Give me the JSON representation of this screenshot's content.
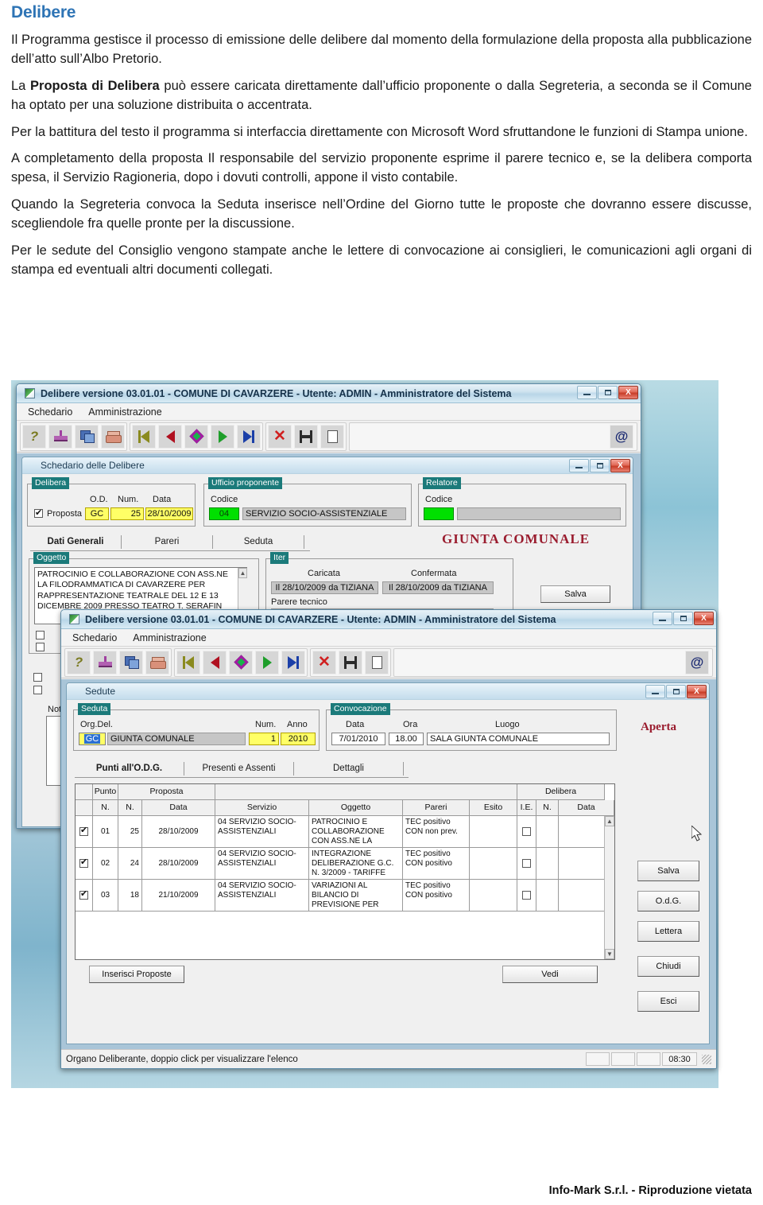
{
  "document": {
    "title": "Delibere",
    "paragraphs": [
      "Il Programma gestisce il processo di emissione delle delibere dal momento della formulazione della proposta alla pubblicazione dell’atto sull’Albo Pretorio.",
      "La <b>Proposta di Delibera</b> può essere caricata direttamente dall’ufficio proponente o dalla Segreteria, a seconda se il Comune ha optato per una soluzione distribuita o accentrata.",
      "Per la battitura del testo il programma si interfaccia direttamente con Microsoft Word sfruttandone le funzioni di Stampa unione.",
      "A completamento della proposta Il responsabile del servizio proponente esprime il parere tecnico e, se la delibera comporta spesa, il Servizio Ragioneria, dopo i dovuti controlli, appone il visto contabile.",
      "Quando la Segreteria convoca la Seduta inserisce nell’Ordine del Giorno tutte le proposte che dovranno essere discusse, scegliendole fra quelle pronte per la discussione.",
      "Per le sedute del Consiglio vengono stampate anche le lettere di convocazione ai consiglieri, le comunicazioni agli organi di stampa ed eventuali altri documenti collegati."
    ],
    "footer": "Info-Mark S.r.l. -  Riproduzione vietata"
  },
  "app": {
    "title": "Delibere versione 03.01.01 - COMUNE DI CAVARZERE - Utente: ADMIN - Amministratore del Sistema",
    "menu": [
      "Schedario",
      "Amministrazione"
    ],
    "toolbar_icons": [
      "help-icon",
      "stamp-icon",
      "copy-icon",
      "print-icon",
      "first-record-icon",
      "previous-record-icon",
      "find-icon",
      "next-record-icon",
      "last-record-icon",
      "delete-icon",
      "save-icon",
      "new-icon",
      "email-icon"
    ],
    "window_buttons": [
      "minimize",
      "maximize",
      "close"
    ],
    "close_glyph": "X"
  },
  "window_back": {
    "child_title": "Schedario delle Delibere",
    "delibera": {
      "group_label": "Delibera",
      "checkbox_label": "Proposta",
      "checkbox_checked": true,
      "col_od": "O.D.",
      "col_num": "Num.",
      "col_data": "Data",
      "od": "GC",
      "num": "25",
      "data": "28/10/2009"
    },
    "ufficio": {
      "group_label": "Ufficio proponente",
      "codice_label": "Codice",
      "codice": "04",
      "descrizione": "SERVIZIO SOCIO-ASSISTENZIALE"
    },
    "relatore": {
      "group_label": "Relatore",
      "codice_label": "Codice",
      "codice": "",
      "descrizione": ""
    },
    "organo": "GIUNTA COMUNALE",
    "tabs": [
      "Dati Generali",
      "Pareri",
      "Seduta"
    ],
    "tab_selected": "Dati Generali",
    "oggetto": {
      "group_label": "Oggetto",
      "text": "PATROCINIO E COLLABORAZIONE CON ASS.NE LA FILODRAMMATICA DI CAVARZERE PER RAPPRESENTAZIONE TEATRALE DEL 12 E 13 DICEMBRE 2009 PRESSO TEATRO T. SERAFIN"
    },
    "note_label": "Note",
    "iter": {
      "group_label": "Iter",
      "caricata_label": "Caricata",
      "confermata_label": "Confermata",
      "caricata_value": "Il 28/10/2009 da TIZIANA",
      "confermata_value": "Il 28/10/2009 da TIZIANA",
      "parere_label": "Parere tecnico"
    },
    "salva_button": "Salva"
  },
  "window_front": {
    "child_title": "Sedute",
    "seduta": {
      "group_label": "Seduta",
      "orgdel_label": "Org.Del.",
      "orgdel_code": "GC",
      "orgdel_desc": "GIUNTA COMUNALE",
      "num_label": "Num.",
      "num": "1",
      "anno_label": "Anno",
      "anno": "2010"
    },
    "convocazione": {
      "group_label": "Convocazione",
      "data_label": "Data",
      "data": "7/01/2010",
      "ora_label": "Ora",
      "ora": "18.00",
      "luogo_label": "Luogo",
      "luogo": "SALA GIUNTA COMUNALE"
    },
    "stato": "Aperta",
    "tabs": [
      "Punti all'O.D.G.",
      "Presenti e Assenti",
      "Dettagli"
    ],
    "tab_selected": "Punti all'O.D.G.",
    "grid": {
      "group_headers": [
        "",
        "Punto",
        "Proposta",
        "",
        "Delibera"
      ],
      "columns": [
        "",
        "N.",
        "N.",
        "Data",
        "Servizio",
        "Oggetto",
        "Pareri",
        "Esito",
        "I.E.",
        "N.",
        "Data"
      ],
      "rows": [
        {
          "checked": true,
          "punto": "01",
          "prop_num": "25",
          "prop_data": "28/10/2009",
          "servizio": "04 SERVIZIO SOCIO-ASSISTENZIALI",
          "oggetto": "PATROCINIO E COLLABORAZIONE CON ASS.NE LA",
          "pareri": "TEC positivo CON non prev.",
          "esito": "",
          "ie": false,
          "del_num": "",
          "del_data": ""
        },
        {
          "checked": true,
          "punto": "02",
          "prop_num": "24",
          "prop_data": "28/10/2009",
          "servizio": "04 SERVIZIO SOCIO-ASSISTENZIALI",
          "oggetto": "INTEGRAZIONE DELIBERAZIONE G.C. N. 3/2009 - TARIFFE",
          "pareri": "TEC positivo CON positivo",
          "esito": "",
          "ie": false,
          "del_num": "",
          "del_data": ""
        },
        {
          "checked": true,
          "punto": "03",
          "prop_num": "18",
          "prop_data": "21/10/2009",
          "servizio": "04 SERVIZIO SOCIO-ASSISTENZIALI",
          "oggetto": "VARIAZIONI AL BILANCIO DI PREVISIONE PER",
          "pareri": "TEC positivo CON positivo",
          "esito": "",
          "ie": false,
          "del_num": "",
          "del_data": ""
        }
      ]
    },
    "buttons_bottom": [
      "Inserisci Proposte",
      "Vedi"
    ],
    "buttons_side": [
      "Salva",
      "O.d.G.",
      "Lettera",
      "Chiudi",
      "Esci"
    ],
    "statusbar": {
      "message": "Organo Deliberante, doppio click per visualizzare l'elenco",
      "time": "08:30"
    }
  }
}
